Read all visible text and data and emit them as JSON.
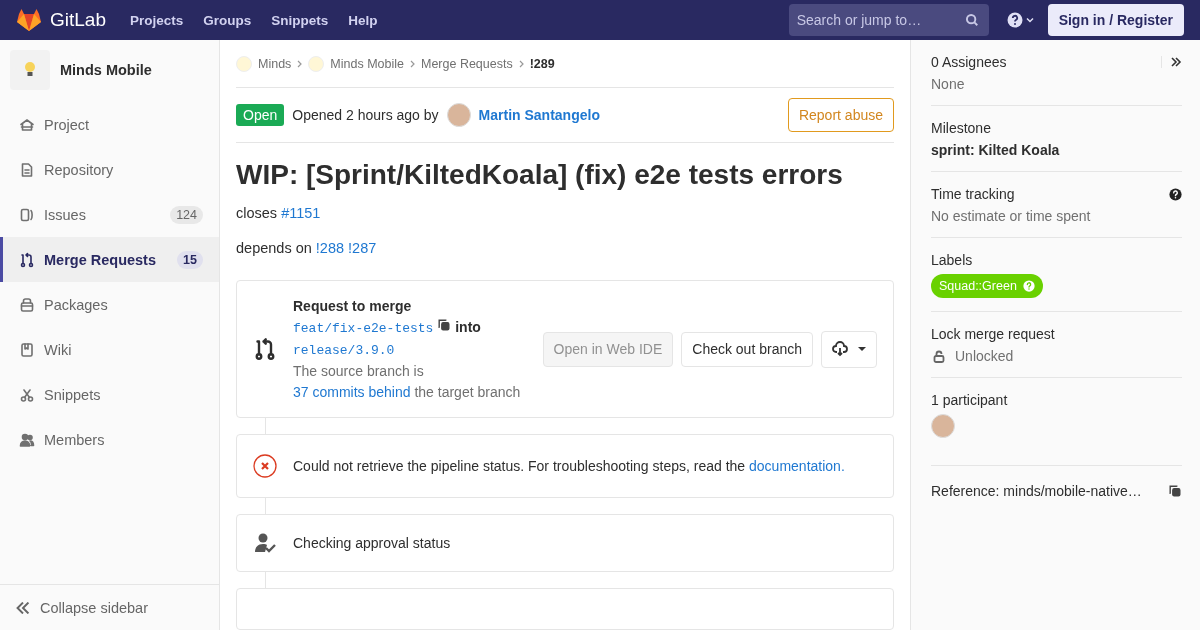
{
  "header": {
    "logo_text": "GitLab",
    "nav": [
      "Projects",
      "Groups",
      "Snippets",
      "Help"
    ],
    "search": {
      "placeholder": "Search or jump to…"
    },
    "sign_in": "Sign in / Register"
  },
  "sidebar": {
    "project_name": "Minds Mobile",
    "items": [
      {
        "label": "Project",
        "selected": false
      },
      {
        "label": "Repository",
        "selected": false
      },
      {
        "label": "Issues",
        "count": "124",
        "selected": false
      },
      {
        "label": "Merge Requests",
        "count": "15",
        "selected": true
      },
      {
        "label": "Packages",
        "selected": false
      },
      {
        "label": "Wiki",
        "selected": false
      },
      {
        "label": "Snippets",
        "selected": false
      },
      {
        "label": "Members",
        "selected": false
      }
    ],
    "collapse": "Collapse sidebar"
  },
  "breadcrumbs": [
    {
      "label": "Minds",
      "kind": "group",
      "selected": false
    },
    {
      "label": "Minds Mobile",
      "kind": "group",
      "selected": false
    },
    {
      "label": "Merge Requests",
      "kind": "page",
      "selected": false
    },
    {
      "label": "!289",
      "kind": "page",
      "selected": true
    }
  ],
  "status": {
    "badge": "Open",
    "opened": "Opened 2 hours ago by",
    "author": "Martin Santangelo",
    "report": "Report abuse"
  },
  "title": "WIP: [Sprint/KiltedKoala] (fix) e2e tests errors",
  "description": [
    {
      "prefix": "closes",
      "links": [
        "#1151"
      ]
    },
    {
      "prefix": "depends on",
      "links": [
        "!288",
        "!287"
      ]
    }
  ],
  "merge_widget": {
    "heading": "Request to merge",
    "source": "feat/fix-e2e-tests",
    "into": "into",
    "target": "release/3.9.0",
    "behind": {
      "before": "The source branch is",
      "link": "37 commits behind",
      "after": "the target branch"
    },
    "buttons": [
      {
        "label": "Open in Web IDE",
        "disabled": true
      },
      {
        "label": "Check out branch",
        "disabled": false
      }
    ]
  },
  "pipeline": {
    "text": "Could not retrieve the pipeline status. For troubleshooting steps, read the",
    "link": "documentation."
  },
  "approval": "Checking approval status",
  "right_sidebar": {
    "assignees": {
      "title": "0 Assignees",
      "value": "None"
    },
    "milestone": {
      "title": "Milestone",
      "value": "sprint: Kilted Koala"
    },
    "time_tracking": {
      "title": "Time tracking",
      "value": "No estimate or time spent"
    },
    "labels": {
      "title": "Labels",
      "items": [
        {
          "text": "Squad::Green",
          "color": "#69d100"
        }
      ]
    },
    "lock": {
      "title": "Lock merge request",
      "value": "Unlocked"
    },
    "participants": {
      "title": "1 participant"
    },
    "reference": "Reference: minds/mobile-native…"
  }
}
